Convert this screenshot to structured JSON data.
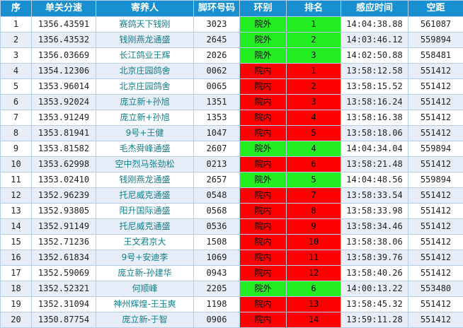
{
  "headers": [
    "序",
    "单关分速",
    "寄养人",
    "脚环号码",
    "环别",
    "排名",
    "感应时间",
    "空距"
  ],
  "colors": {
    "header_bg": "#178fd0",
    "outer": "#22ee22",
    "inner": "#ff0000",
    "row_alt": "#e7eefa",
    "name_text": "#0f7f8c"
  },
  "rows": [
    {
      "no": "1",
      "speed": "1356.43591",
      "owner": "赛鸽天下钱刚",
      "ring": "3023",
      "type": "院外",
      "tclass": "outer",
      "rank": "1",
      "time": "14:04:38.88",
      "dist": "561087"
    },
    {
      "no": "2",
      "speed": "1356.43532",
      "owner": "钱刚燕龙通盛",
      "ring": "2645",
      "type": "院外",
      "tclass": "outer",
      "rank": "2",
      "time": "14:03:46.12",
      "dist": "559894"
    },
    {
      "no": "3",
      "speed": "1356.03669",
      "owner": "长江鸽业王辉",
      "ring": "2026",
      "type": "院外",
      "tclass": "outer",
      "rank": "3",
      "time": "14:02:50.88",
      "dist": "558481"
    },
    {
      "no": "4",
      "speed": "1354.12306",
      "owner": "北京庄园鸽舍",
      "ring": "0062",
      "type": "院内",
      "tclass": "inner",
      "rank": "1",
      "time": "13:58:12.58",
      "dist": "551412"
    },
    {
      "no": "5",
      "speed": "1353.96014",
      "owner": "北京庄园鸽舍",
      "ring": "0065",
      "type": "院内",
      "tclass": "inner",
      "rank": "2",
      "time": "13:58:15.52",
      "dist": "551412"
    },
    {
      "no": "6",
      "speed": "1353.92024",
      "owner": "庞立新+孙旭",
      "ring": "1351",
      "type": "院内",
      "tclass": "inner",
      "rank": "3",
      "time": "13:58:16.24",
      "dist": "551412"
    },
    {
      "no": "7",
      "speed": "1353.91249",
      "owner": "庞立新+孙旭",
      "ring": "1353",
      "type": "院内",
      "tclass": "inner",
      "rank": "4",
      "time": "13:58:16.38",
      "dist": "551412"
    },
    {
      "no": "8",
      "speed": "1353.81941",
      "owner": "9号+王健",
      "ring": "1047",
      "type": "院内",
      "tclass": "inner",
      "rank": "5",
      "time": "13:58:18.06",
      "dist": "551412"
    },
    {
      "no": "9",
      "speed": "1353.81582",
      "owner": "毛杰舜峰通盛",
      "ring": "2607",
      "type": "院外",
      "tclass": "outer",
      "rank": "4",
      "time": "14:04:34.04",
      "dist": "559894"
    },
    {
      "no": "10",
      "speed": "1353.62998",
      "owner": "空中烈马张劲松",
      "ring": "0213",
      "type": "院内",
      "tclass": "inner",
      "rank": "6",
      "time": "13:58:21.48",
      "dist": "551412"
    },
    {
      "no": "11",
      "speed": "1353.02410",
      "owner": "钱刚燕龙通盛",
      "ring": "2657",
      "type": "院外",
      "tclass": "outer",
      "rank": "5",
      "time": "14:04:48.56",
      "dist": "559894"
    },
    {
      "no": "12",
      "speed": "1352.96239",
      "owner": "托尼威克通盛",
      "ring": "0548",
      "type": "院内",
      "tclass": "inner",
      "rank": "7",
      "time": "13:58:33.54",
      "dist": "551412"
    },
    {
      "no": "13",
      "speed": "1352.93805",
      "owner": "阳升国际通盛",
      "ring": "0568",
      "type": "院内",
      "tclass": "inner",
      "rank": "8",
      "time": "13:58:33.98",
      "dist": "551412"
    },
    {
      "no": "14",
      "speed": "1352.91149",
      "owner": "托尼威克通盛",
      "ring": "0536",
      "type": "院内",
      "tclass": "inner",
      "rank": "9",
      "time": "13:58:34.46",
      "dist": "551412"
    },
    {
      "no": "15",
      "speed": "1352.71236",
      "owner": "王文君京大",
      "ring": "1508",
      "type": "院内",
      "tclass": "inner",
      "rank": "10",
      "time": "13:58:38.06",
      "dist": "551412"
    },
    {
      "no": "16",
      "speed": "1352.61834",
      "owner": "9号+安迪李",
      "ring": "1069",
      "type": "院内",
      "tclass": "inner",
      "rank": "11",
      "time": "13:58:39.76",
      "dist": "551412"
    },
    {
      "no": "17",
      "speed": "1352.59069",
      "owner": "庞立新-孙建华",
      "ring": "0943",
      "type": "院内",
      "tclass": "inner",
      "rank": "12",
      "time": "13:58:40.26",
      "dist": "551412"
    },
    {
      "no": "18",
      "speed": "1352.52321",
      "owner": "何顺峰",
      "ring": "2205",
      "type": "院外",
      "tclass": "outer",
      "rank": "6",
      "time": "14:00:13.22",
      "dist": "553480"
    },
    {
      "no": "19",
      "speed": "1352.31094",
      "owner": "神州辉煌-王玉爽",
      "ring": "1198",
      "type": "院内",
      "tclass": "inner",
      "rank": "13",
      "time": "13:58:45.32",
      "dist": "551412"
    },
    {
      "no": "20",
      "speed": "1350.87754",
      "owner": "庞立新-于智",
      "ring": "0906",
      "type": "院内",
      "tclass": "inner",
      "rank": "14",
      "time": "13:59:11.28",
      "dist": "551412"
    }
  ]
}
